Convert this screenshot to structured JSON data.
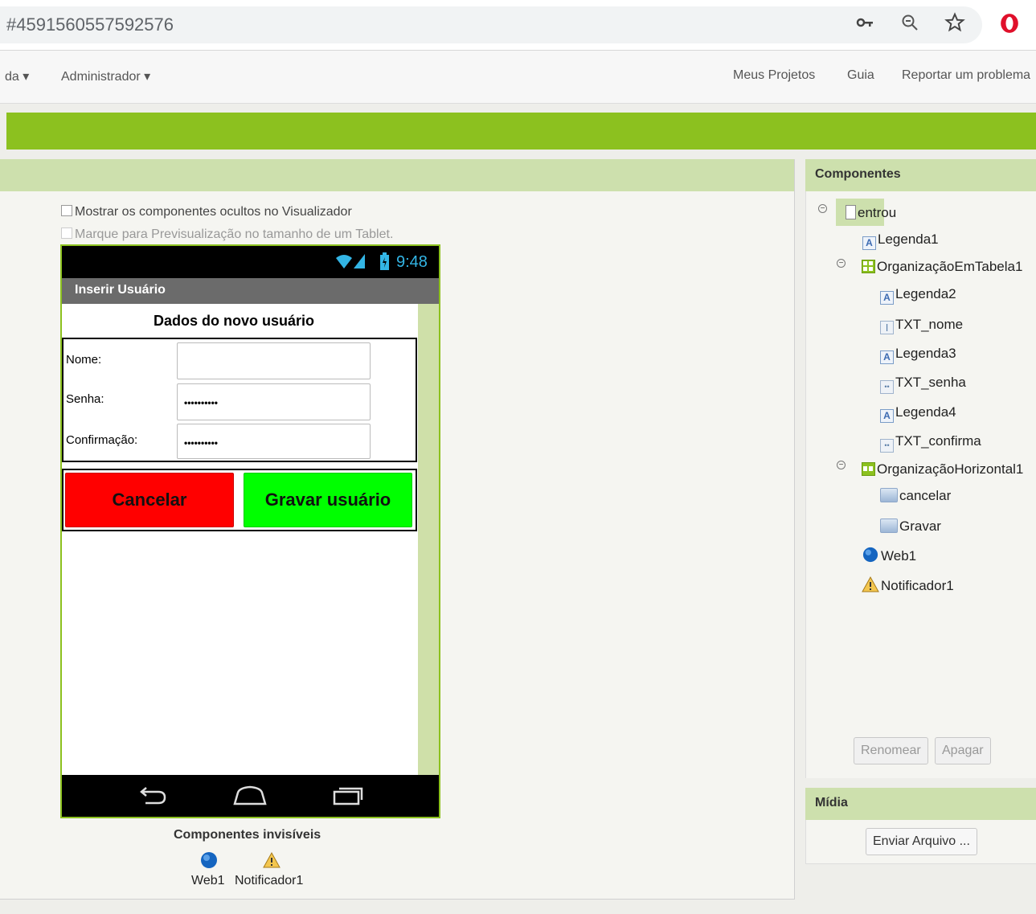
{
  "browser": {
    "url": "‎#4591560557592576",
    "icons": [
      "key-icon",
      "zoom-icon",
      "star-icon",
      "opera-icon"
    ]
  },
  "menu": {
    "partial_left": "da ▾",
    "admin": "Administrador ▾",
    "my_projects": "Meus Projetos",
    "guide": "Guia",
    "report": "Reportar um problema"
  },
  "viewer": {
    "show_hidden": "Mostrar os componentes ocultos no Visualizador",
    "tablet_preview": "Marque para Previsualização no tamanho de um Tablet.",
    "status_time": "9:48",
    "screen_title": "Inserir Usuário",
    "form_heading": "Dados do novo usuário",
    "fields": [
      {
        "label": "Nome:",
        "value": ""
      },
      {
        "label": "Senha:",
        "value": "••••••••••"
      },
      {
        "label": "Confirmação:",
        "value": "••••••••••"
      }
    ],
    "cancel_label": "Cancelar",
    "save_label": "Gravar usuário",
    "invisible_title": "Componentes invisíveis",
    "invisible": [
      {
        "name": "Web1",
        "icon": "globe-icon"
      },
      {
        "name": "Notificador1",
        "icon": "warning-icon"
      }
    ]
  },
  "components": {
    "title": "Componentes",
    "tree": [
      {
        "label": "entrou",
        "icon": "screen-icon"
      },
      {
        "label": "Legenda1",
        "icon": "label-icon"
      },
      {
        "label": "OrganizaçãoEmTabela1",
        "icon": "table-arrangement-icon"
      },
      {
        "label": "Legenda2",
        "icon": "label-icon"
      },
      {
        "label": "TXT_nome",
        "icon": "textbox-icon"
      },
      {
        "label": "Legenda3",
        "icon": "label-icon"
      },
      {
        "label": "TXT_senha",
        "icon": "password-icon"
      },
      {
        "label": "Legenda4",
        "icon": "label-icon"
      },
      {
        "label": "TXT_confirma",
        "icon": "password-icon"
      },
      {
        "label": "OrganizaçãoHorizontal1",
        "icon": "horizontal-arrangement-icon"
      },
      {
        "label": "cancelar",
        "icon": "button-icon"
      },
      {
        "label": "Gravar",
        "icon": "button-icon"
      },
      {
        "label": "Web1",
        "icon": "globe-icon"
      },
      {
        "label": "Notificador1",
        "icon": "warning-icon"
      }
    ],
    "rename_label": "Renomear",
    "delete_label": "Apagar"
  },
  "media": {
    "title": "Mídia",
    "upload_label": "Enviar Arquivo ..."
  },
  "colors": {
    "accent_green": "#8cc11f",
    "panel_header": "#cde0ad",
    "cancel_button": "#ff0000",
    "save_button": "#00ff00"
  }
}
